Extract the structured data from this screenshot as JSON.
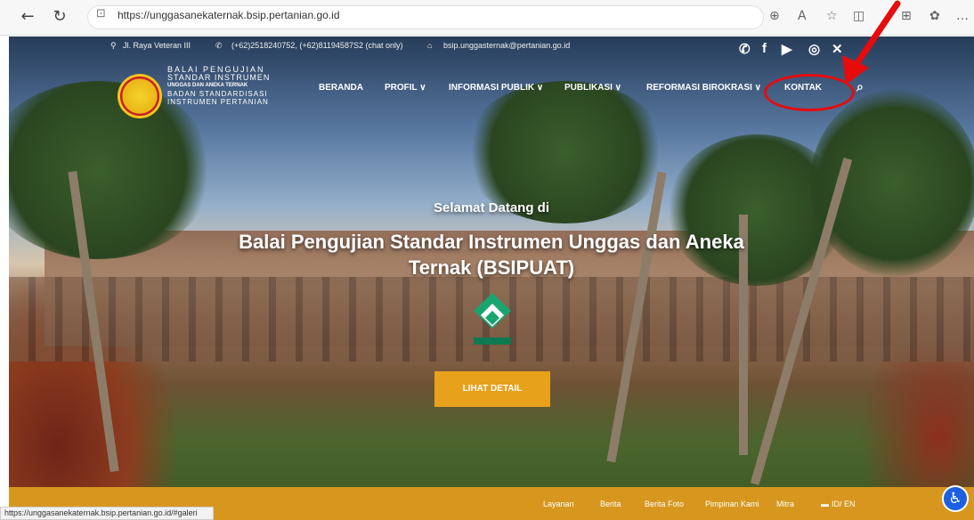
{
  "browser": {
    "url": "https://unggasanekaternak.bsip.pertanian.go.id",
    "back_icon": "arrow-left-icon",
    "reload_icon": "reload-icon"
  },
  "topbar": {
    "address": "Jl. Raya Veteran III",
    "phone": "(+62)2518240752, (+62)81194587S2 (chat only)",
    "email": "bsip.unggasternak@pertanian.go.id"
  },
  "logo": {
    "line1": "BALAI PENGUJIAN",
    "line2": "STANDAR INSTRUMEN",
    "line3": "UNGGAS DAN ANEKA TERNAK",
    "line4": "BADAN STANDARDISASI",
    "line5": "INSTRUMEN PERTANIAN"
  },
  "menu": {
    "beranda": "BERANDA",
    "profil": "PROFIL ∨",
    "informasi": "INFORMASI PUBLIK ∨",
    "publikasi": "PUBLIKASI ∨",
    "reformasi": "REFORMASI BIROKRASI ∨",
    "kontak": "KONTAK"
  },
  "hero": {
    "greeting": "Selamat Datang di",
    "title_line1": "Balai Pengujian Standar Instrumen Unggas dan Aneka",
    "title_line2": "Ternak (BSIPUAT)",
    "button": "LIHAT DETAIL"
  },
  "footer": {
    "items": [
      "Layanan",
      "Berita",
      "Berita Foto",
      "Pimpinan Kami",
      "Mitra",
      "ID/ EN"
    ]
  },
  "status_bar": "https://unggasanekaternak.bsip.pertanian.go.id/#galeri",
  "colors": {
    "accent": "#e7a11a",
    "footer": "#d7971f",
    "annotation": "#e80b0b"
  }
}
